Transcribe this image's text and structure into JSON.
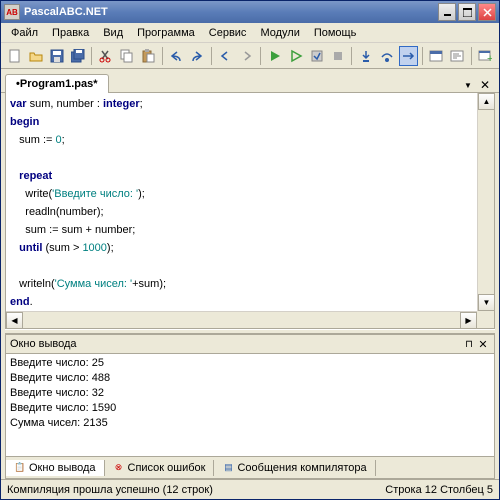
{
  "title": "PascalABC.NET",
  "menu": [
    "Файл",
    "Правка",
    "Вид",
    "Программа",
    "Сервис",
    "Модули",
    "Помощь"
  ],
  "tab": "•Program1.pas*",
  "code": {
    "l1a": "var",
    "l1b": " sum, number : ",
    "l1c": "integer",
    "l1d": ";",
    "l2": "begin",
    "l3a": "   sum := ",
    "l3b": "0",
    "l3c": ";",
    "l4": " ",
    "l5a": "   ",
    "l5b": "repeat",
    "l6a": "     write(",
    "l6b": "'Введите число: '",
    "l6c": ");",
    "l7": "     readln(number);",
    "l8": "     sum := sum + number;",
    "l9a": "   ",
    "l9b": "until",
    "l9c": " (sum > ",
    "l9d": "1000",
    "l9e": ");",
    "l10": " ",
    "l11a": "   writeln(",
    "l11b": "'Сумма чисел: '",
    "l11c": "+sum);",
    "l12a": "end",
    "l12b": "."
  },
  "output_title": "Окно вывода",
  "output": {
    "l1": "Введите число: 25",
    "l2": "Введите число: 488",
    "l3": "Введите число: 32",
    "l4": "Введите число: 1590",
    "l5": "Сумма чисел: 2135"
  },
  "bottom_tabs": {
    "t1": "Окно вывода",
    "t2": "Список ошибок",
    "t3": "Сообщения компилятора"
  },
  "status": {
    "left": "Компиляция прошла успешно (12 строк)",
    "line": "Строка",
    "line_num": "12",
    "col": "Столбец",
    "col_num": "5"
  },
  "icons": {
    "app": "AB"
  }
}
